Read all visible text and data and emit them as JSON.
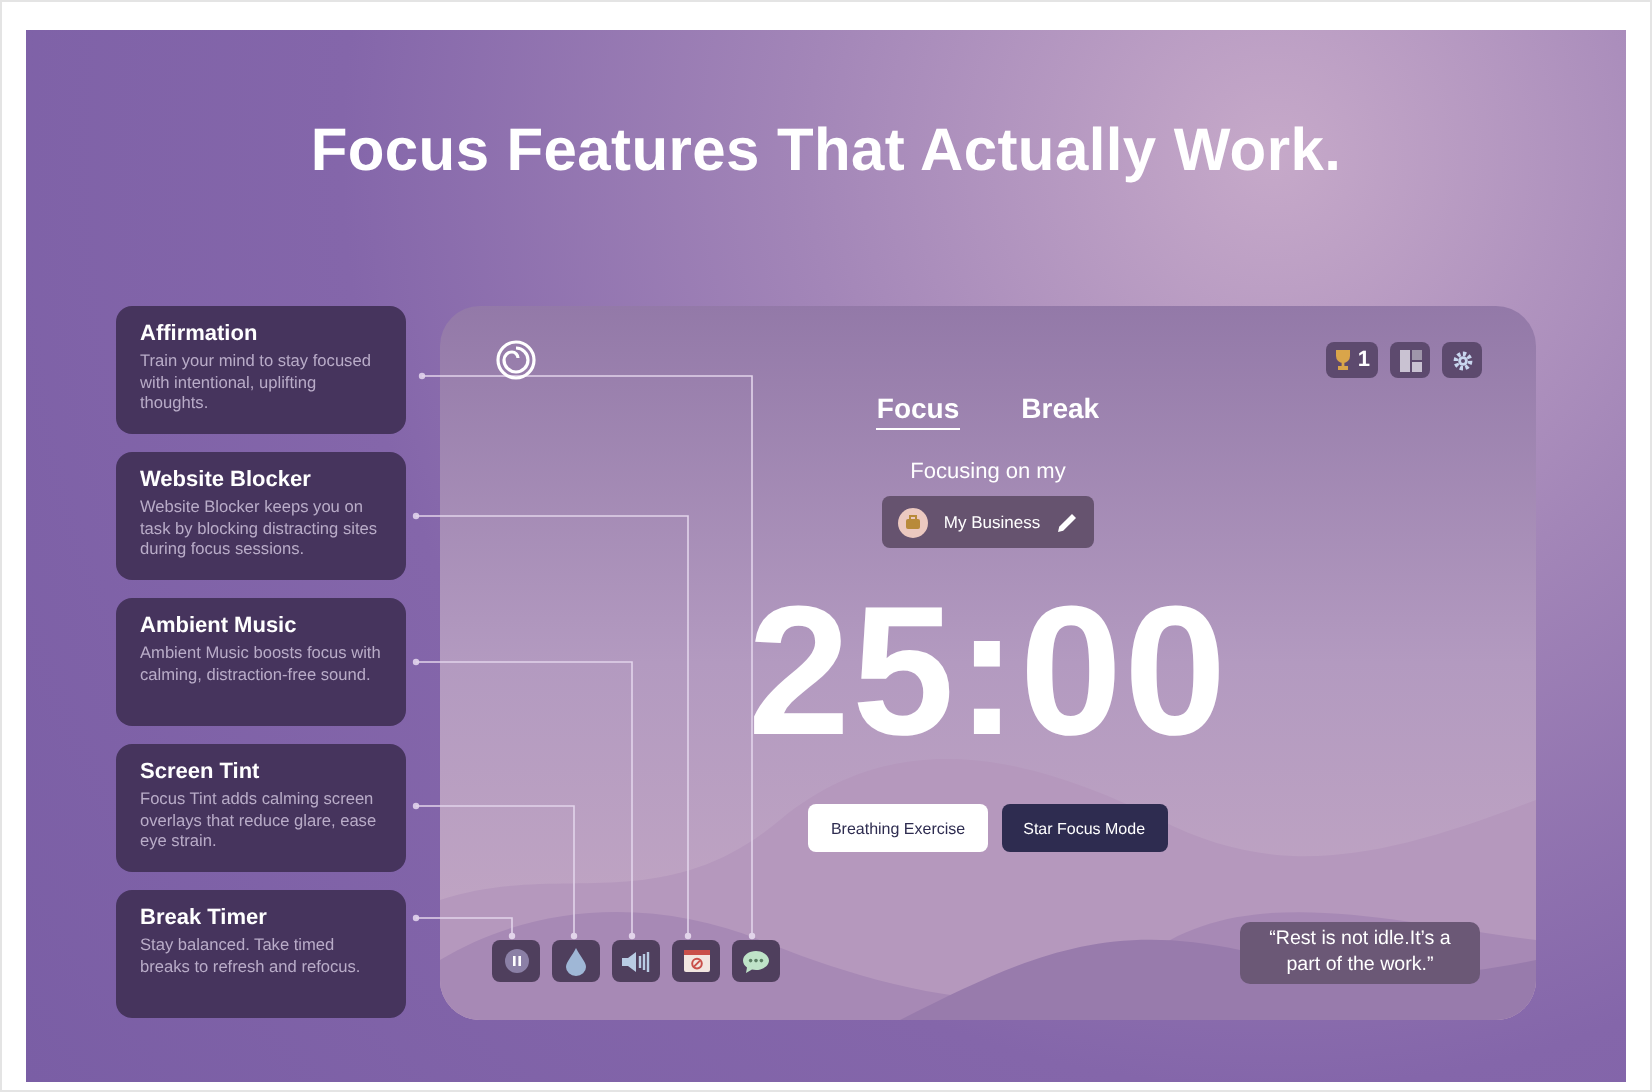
{
  "title": "Focus Features That Actually Work.",
  "features": [
    {
      "title": "Affirmation",
      "description": "Train your mind to stay focused with intentional, uplifting thoughts."
    },
    {
      "title": "Website Blocker",
      "description": "Website Blocker keeps you on task by blocking distracting sites during focus sessions."
    },
    {
      "title": "Ambient Music",
      "description": "Ambient Music boosts focus with calming, distraction-free sound."
    },
    {
      "title": "Screen Tint",
      "description": "Focus Tint adds calming screen overlays that reduce glare, ease eye strain."
    },
    {
      "title": "Break Timer",
      "description": "Stay balanced. Take timed breaks to refresh and refocus."
    }
  ],
  "app": {
    "trophy_count": "1",
    "tabs": [
      {
        "label": "Focus",
        "selected": true
      },
      {
        "label": "Break",
        "selected": false
      }
    ],
    "focus_label": "Focusing on my",
    "task": "My Business",
    "timer": "25:00",
    "buttons": [
      {
        "label": "Breathing Exercise",
        "kind": "light"
      },
      {
        "label": "Star Focus Mode",
        "kind": "dark"
      }
    ],
    "tools": [
      {
        "kind": "pause"
      },
      {
        "kind": "drop"
      },
      {
        "kind": "sound"
      },
      {
        "kind": "block"
      },
      {
        "kind": "chat"
      }
    ],
    "quote": "“Rest is not idle.It’s a part of the work.”"
  }
}
